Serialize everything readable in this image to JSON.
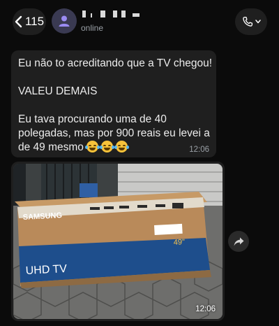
{
  "header": {
    "back_count": "115",
    "status": "online"
  },
  "messages": [
    {
      "type": "text",
      "lines": [
        "Eu não to acreditando que a TV chegou!",
        "",
        "VALEU DEMAIS",
        "",
        "Eu tava procurando uma de 40",
        "polegadas, mas por 900 reais eu levei a",
        "de 49 mesmo"
      ],
      "emoji_count": 3,
      "emoji": "laughing-tears",
      "time": "12:06"
    },
    {
      "type": "image",
      "box_brand": "SAMSUNG",
      "box_label": "UHD TV",
      "box_size": "49\"",
      "time": "12:06"
    }
  ],
  "colors": {
    "background": "#0b0b0b",
    "bubble": "#1f1f1f",
    "text": "#ececec",
    "muted": "#9aa0a6",
    "box_blue": "#1e4e8c",
    "box_cardboard": "#b98a5a"
  },
  "icons": {
    "back": "chevron-left-icon",
    "avatar": "person-icon",
    "call": "phone-icon",
    "call_menu": "chevron-down-icon",
    "forward": "share-forward-icon"
  }
}
